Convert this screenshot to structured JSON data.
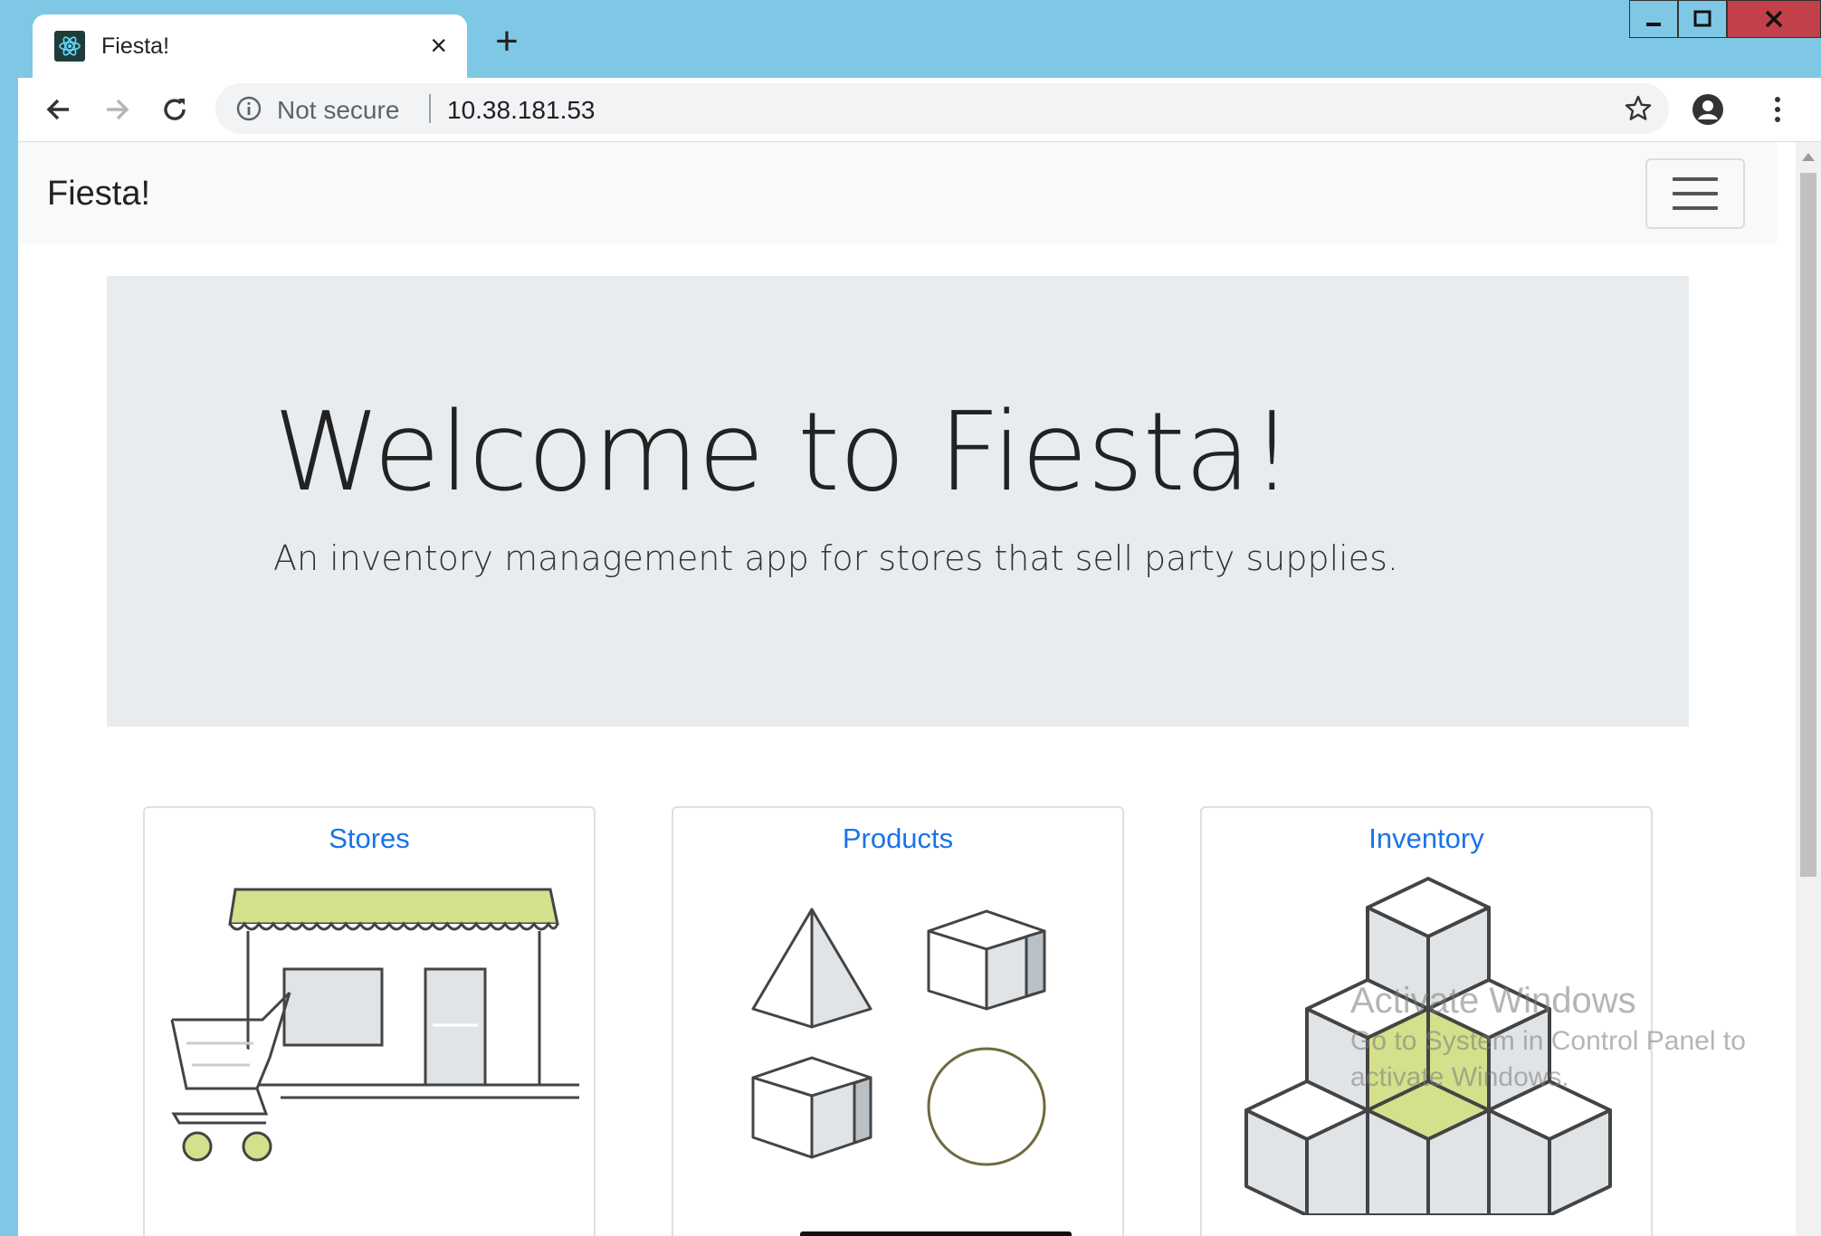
{
  "browser": {
    "tab_title": "Fiesta!",
    "tab_close": "×",
    "new_tab": "+",
    "security_label": "Not secure",
    "url": "10.38.181.53"
  },
  "app": {
    "brand": "Fiesta!",
    "hero_title": "Welcome to Fiesta!",
    "hero_subtitle": "An inventory management app for stores that sell party supplies."
  },
  "cards": [
    {
      "label": "Stores",
      "icon": "storefront-cart-icon"
    },
    {
      "label": "Products",
      "icon": "shapes-icon"
    },
    {
      "label": "Inventory",
      "icon": "stacked-cubes-icon"
    }
  ],
  "watermark": {
    "line1": "Activate Windows",
    "line2": "Go to System in Control Panel to",
    "line3": "activate Windows."
  },
  "colors": {
    "chrome_frame": "#7ec8e6",
    "link": "#1a73e8",
    "accent_green": "#d4e08c",
    "close_button": "#c1404a"
  }
}
